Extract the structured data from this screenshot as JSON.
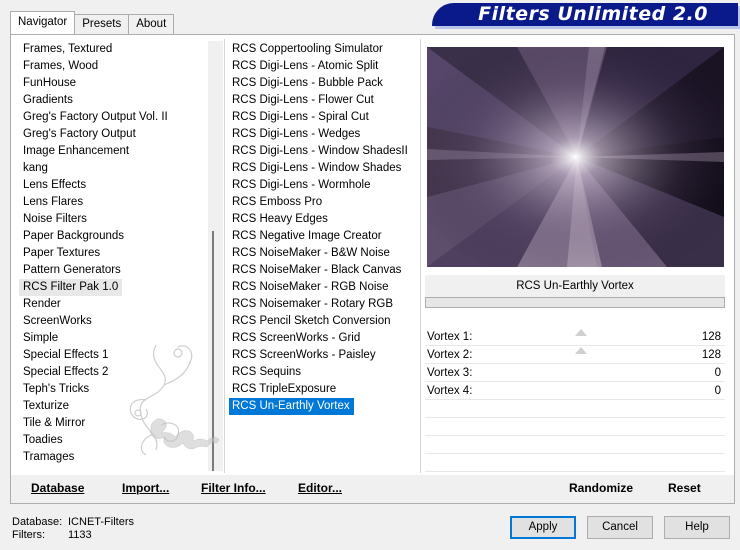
{
  "tabs": [
    {
      "label": "Navigator"
    },
    {
      "label": "Presets"
    },
    {
      "label": "About"
    }
  ],
  "banner": {
    "title": "Filters Unlimited 2.0"
  },
  "categories": [
    "Frames, Textured",
    "Frames, Wood",
    "FunHouse",
    "Gradients",
    "Greg's Factory Output Vol. II",
    "Greg's Factory Output",
    "Image Enhancement",
    "kang",
    "Lens Effects",
    "Lens Flares",
    "Noise Filters",
    "Paper Backgrounds",
    "Paper Textures",
    "Pattern Generators",
    "RCS Filter Pak 1.0",
    "Render",
    "ScreenWorks",
    "Simple",
    "Special Effects 1",
    "Special Effects 2",
    "Teph's Tricks",
    "Texturize",
    "Tile & Mirror",
    "Toadies",
    "Tramages"
  ],
  "selected_category": "RCS Filter Pak 1.0",
  "filters": [
    "RCS Coppertooling Simulator",
    "RCS Digi-Lens - Atomic Split",
    "RCS Digi-Lens - Bubble Pack",
    "RCS Digi-Lens - Flower Cut",
    "RCS Digi-Lens - Spiral Cut",
    "RCS Digi-Lens - Wedges",
    "RCS Digi-Lens - Window ShadesII",
    "RCS Digi-Lens - Window Shades",
    "RCS Digi-Lens - Wormhole",
    "RCS Emboss Pro",
    "RCS Heavy Edges",
    "RCS Negative Image Creator",
    "RCS NoiseMaker - B&W Noise",
    "RCS NoiseMaker - Black Canvas",
    "RCS NoiseMaker - RGB Noise",
    "RCS Noisemaker - Rotary RGB",
    "RCS Pencil Sketch Conversion",
    "RCS ScreenWorks - Grid",
    "RCS ScreenWorks - Paisley",
    "RCS Sequins",
    "RCS TripleExposure",
    "RCS Un-Earthly Vortex"
  ],
  "selected_filter": "RCS Un-Earthly Vortex",
  "preview": {
    "filter_name": "RCS Un-Earthly Vortex"
  },
  "params": [
    {
      "label": "Vortex 1:",
      "value": "128"
    },
    {
      "label": "Vortex 2:",
      "value": "128"
    },
    {
      "label": "Vortex 3:",
      "value": "0"
    },
    {
      "label": "Vortex 4:",
      "value": "0"
    }
  ],
  "toolbar": {
    "database": "Database",
    "import": "Import...",
    "filter_info": "Filter Info...",
    "editor": "Editor...",
    "randomize": "Randomize",
    "reset": "Reset"
  },
  "status": {
    "database_label": "Database:",
    "database_value": "ICNET-Filters",
    "filters_label": "Filters:",
    "filters_value": "1133"
  },
  "buttons": {
    "apply": "Apply",
    "cancel": "Cancel",
    "help": "Help"
  },
  "colors": {
    "banner": "#0a1a8a",
    "selection": "#0078d7",
    "preview_bg": "#1a1326"
  }
}
